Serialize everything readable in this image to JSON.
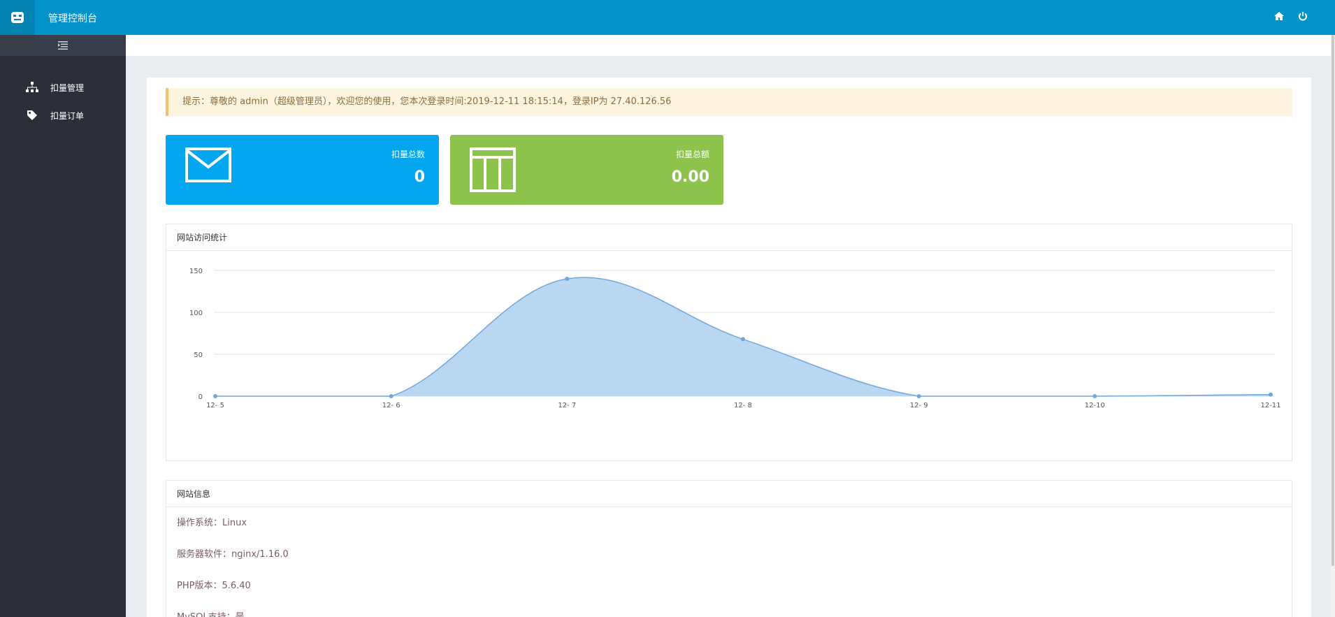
{
  "app": {
    "title": "管理控制台"
  },
  "topbar": {
    "icons": [
      "home-icon",
      "power-icon"
    ]
  },
  "sidebar": {
    "items": [
      {
        "label": "扣量管理",
        "icon": "sitemap-icon"
      },
      {
        "label": "扣量订单",
        "icon": "tag-icon"
      }
    ]
  },
  "notice": {
    "text": "提示：尊敬的 admin（超级管理员），欢迎您的使用，您本次登录时间:2019-12-11 18:15:14，登录IP为 27.40.126.56"
  },
  "stats": {
    "total_count": {
      "label": "扣量总数",
      "value": "0",
      "color": "#03a6ef",
      "icon": "envelope-icon"
    },
    "total_amount": {
      "label": "扣量总额",
      "value": "0.00",
      "color": "#8dc24c",
      "icon": "table-icon"
    }
  },
  "chart_section": {
    "title": "网站访问统计"
  },
  "chart_data": {
    "type": "area",
    "title": "",
    "xlabel": "",
    "ylabel": "",
    "categories": [
      "12- 5",
      "12- 6",
      "12- 7",
      "12- 8",
      "12- 9",
      "12-10",
      "12-11"
    ],
    "series": [
      {
        "values": [
          0,
          0,
          140,
          68,
          0,
          0,
          2
        ]
      }
    ],
    "ylim": [
      0,
      150
    ],
    "yticks": [
      "0",
      "50",
      "100",
      "150"
    ],
    "grid": true,
    "color": "#b9d7f1",
    "line_color": "#6fa8dc"
  },
  "info_section": {
    "title": "网站信息",
    "lines": [
      "操作系统：Linux",
      "服务器软件：nginx/1.16.0",
      "PHP版本：5.6.40",
      "MySQL支持：是"
    ]
  }
}
